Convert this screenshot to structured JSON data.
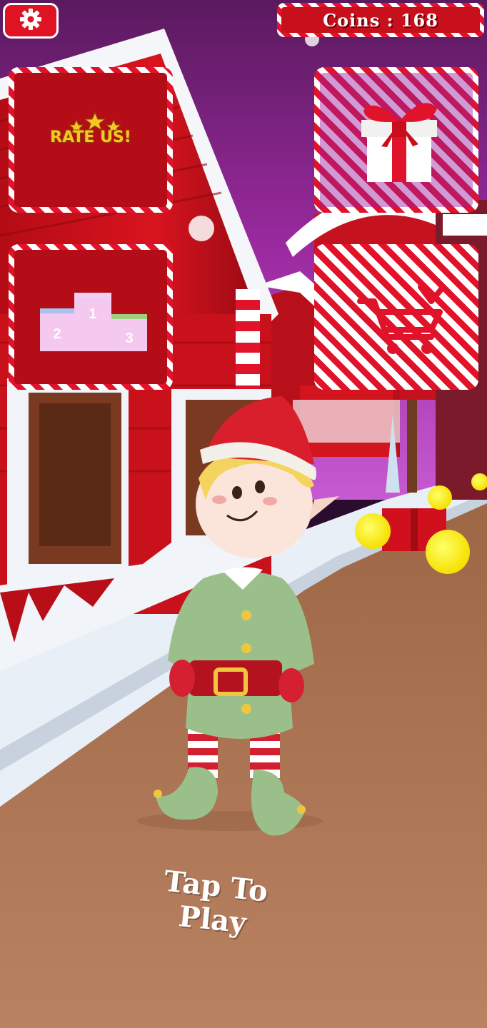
{
  "hud": {
    "settings_icon": "gear-icon",
    "coins_label": "Coins : 168"
  },
  "menu": {
    "rate_us_label": "RATE US!",
    "rate_us_icon": "three-stars-icon",
    "gift_icon": "gift-box-icon",
    "leaderboard_icon": "podium-icon",
    "leaderboard_places": [
      "1",
      "2",
      "3"
    ],
    "shop_icon": "shopping-cart-icon"
  },
  "prompt": {
    "tap_to_play": "Tap To Play"
  },
  "colors": {
    "candy_red": "#e0132a",
    "candy_white": "#ffffff",
    "panel_red": "#b50d17",
    "star_gold": "#f7c626",
    "coin_yellow": "#f5e60a",
    "elf_green": "#9bbf8a",
    "road_brown": "#b07a55"
  }
}
